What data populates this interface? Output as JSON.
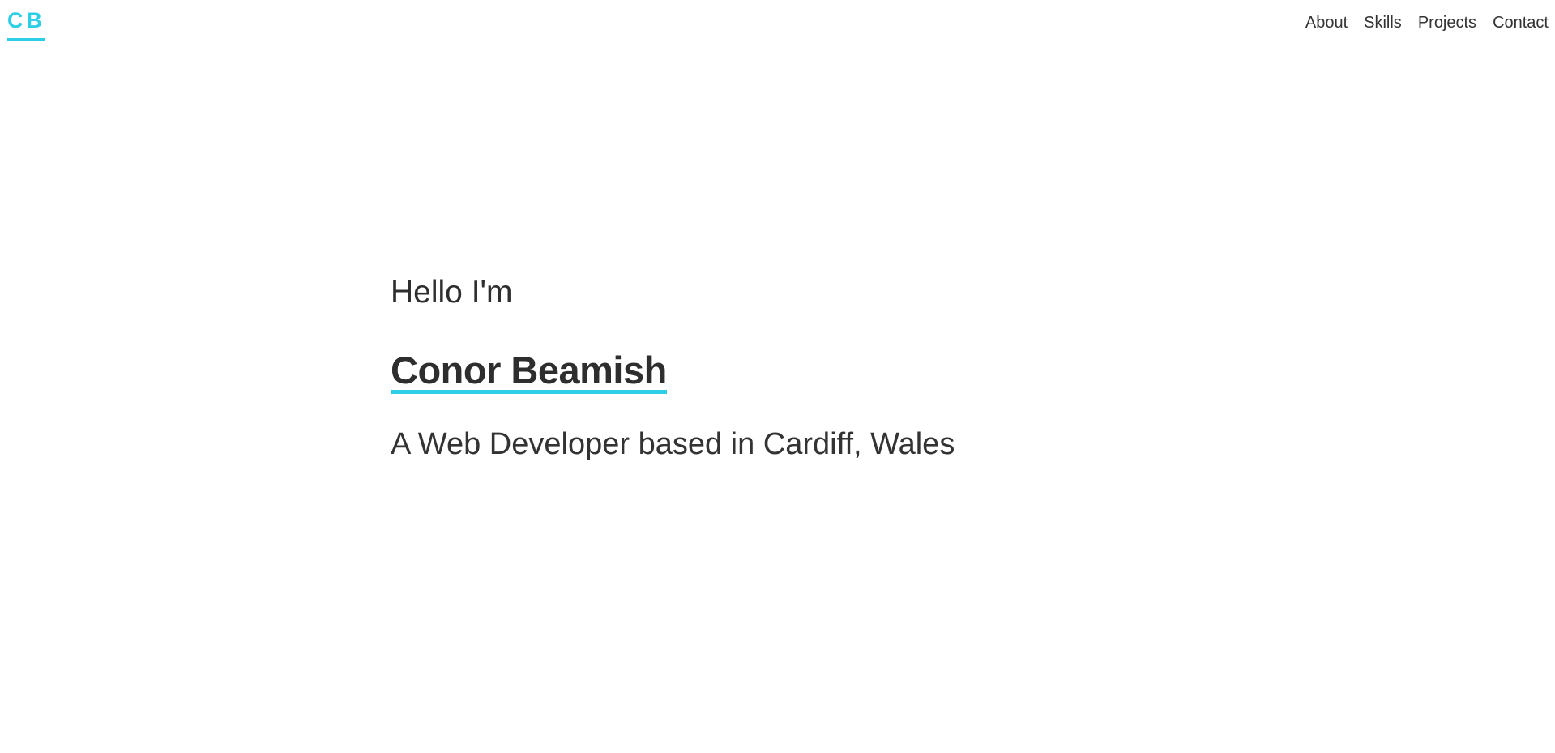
{
  "header": {
    "logo": "CB",
    "nav": [
      {
        "label": "About"
      },
      {
        "label": "Skills"
      },
      {
        "label": "Projects"
      },
      {
        "label": "Contact"
      }
    ]
  },
  "hero": {
    "greeting": "Hello I'm",
    "name": "Conor Beamish",
    "tagline": "A Web Developer based in Cardiff, Wales"
  },
  "colors": {
    "accent": "#2ecfe6",
    "text": "#333333",
    "background": "#ffffff"
  }
}
